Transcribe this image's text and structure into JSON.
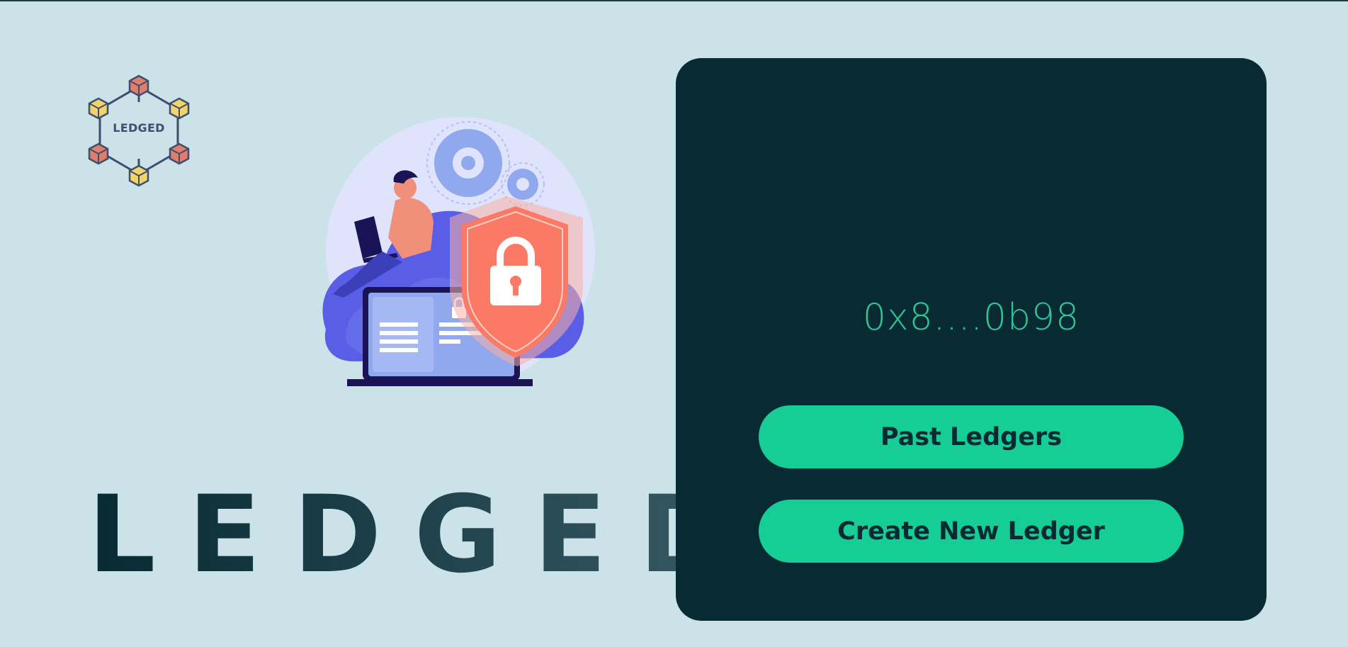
{
  "logo": {
    "text": "LEDGED",
    "icon": "hexagon-blockchain-cubes-logo"
  },
  "hero": {
    "icon": "cloud-security-illustration"
  },
  "brand": {
    "title": "LEDGED"
  },
  "panel": {
    "wallet_address": "0x8....0b98",
    "past_ledgers_label": "Past Ledgers",
    "create_ledger_label": "Create New Ledger"
  },
  "colors": {
    "background": "#cbe2e8",
    "panel": "#072a33",
    "accent": "#16cd96",
    "address": "#2fc493",
    "button_text": "#082a33"
  }
}
